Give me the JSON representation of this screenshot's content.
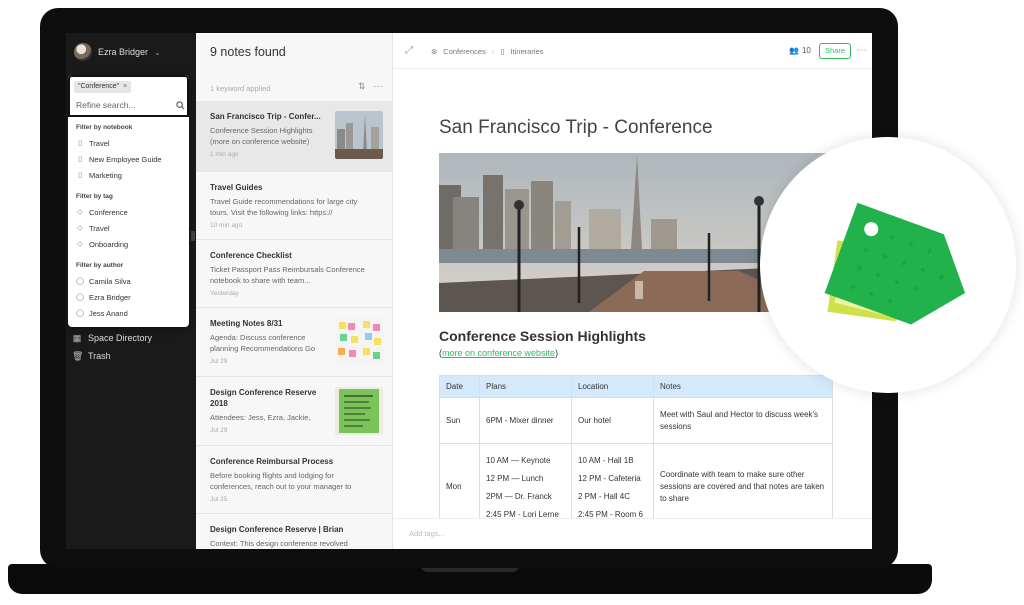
{
  "sidebar": {
    "account_name": "Ezra Bridger",
    "bottom_items": [
      {
        "label": "Space Directory",
        "icon": "building-icon"
      },
      {
        "label": "Trash",
        "icon": "trash-icon"
      }
    ]
  },
  "search": {
    "chip_label": "\"Conference\"",
    "placeholder": "Refine search...",
    "filters": [
      {
        "heading": "Filter by notebook",
        "items": [
          "Travel",
          "New Employee Guide",
          "Marketing"
        ],
        "icon": "notebook-icon"
      },
      {
        "heading": "Filter by tag",
        "items": [
          "Conference",
          "Travel",
          "Onboarding"
        ],
        "icon": "tag-icon"
      },
      {
        "heading": "Filter by author",
        "items": [
          "Camila Silva",
          "Ezra Bridger",
          "Jess Anand"
        ],
        "icon": "person-icon"
      }
    ]
  },
  "note_list": {
    "title": "9 notes found",
    "subtitle": "1 keyword applied",
    "notes": [
      {
        "title": "San Francisco Trip - Confer...",
        "snippet": "Conference Session Highlights (more on conference website)",
        "date": "1 min ago"
      },
      {
        "title": "Travel Guides",
        "snippet": "Travel Guide recommendations for large city tours. Visit the following links: https://",
        "date": "10 min ago"
      },
      {
        "title": "Conference Checklist",
        "snippet": "Ticket Passport Pass Reimbursals Conference notebook to share with team...",
        "date": "Yesterday"
      },
      {
        "title": "Meeting Notes 8/31",
        "snippet": "Agenda: Discuss conference planning Recommendations Go",
        "date": "Jul 29"
      },
      {
        "title": "Design Conference Reserve 2018",
        "snippet": "Attendees: Jess, Ezra, Jackie,",
        "date": "Jul 29"
      },
      {
        "title": "Conference Reimbursal Process",
        "snippet": "Before booking flights and lodging for conferences, reach out to your manager to",
        "date": "Jul 25"
      },
      {
        "title": "Design Conference Reserve | Brian",
        "snippet": "Context: This design conference revolved",
        "date": ""
      }
    ]
  },
  "note": {
    "breadcrumb": [
      "Conferences",
      "Itineraries"
    ],
    "people_count": "10",
    "share_label": "Share",
    "title": "San Francisco Trip - Conference",
    "section_heading": "Conference Session Highlights",
    "link_open": "(",
    "link_text": "more on conference website",
    "link_close": ")",
    "table": {
      "headers": [
        "Date",
        "Plans",
        "Location",
        "Notes"
      ],
      "rows": [
        {
          "date": "Sun",
          "plans": [
            "6PM - Mixer dinner"
          ],
          "location": [
            "Our hotel"
          ],
          "notes": "Meet with Saul and Hector to discuss week's sessions"
        },
        {
          "date": "Mon",
          "plans": [
            "10 AM — Keynote",
            "12 PM — Lunch",
            "2PM — Dr. Franck",
            "2:45 PM - Lori Lerne"
          ],
          "location": [
            "10 AM - Hall 1B",
            "12 PM - Cafeteria",
            "2 PM - Hall 4C",
            "2:45 PM - Room 6"
          ],
          "notes": "Coordinate with team to make sure other sessions are covered and that notes are taken to share"
        }
      ]
    },
    "add_tags": "Add tags..."
  },
  "colors": {
    "accent_green": "#2dbe60",
    "sidebar_bg": "#1a1a1a",
    "table_header": "#d4eafc"
  }
}
